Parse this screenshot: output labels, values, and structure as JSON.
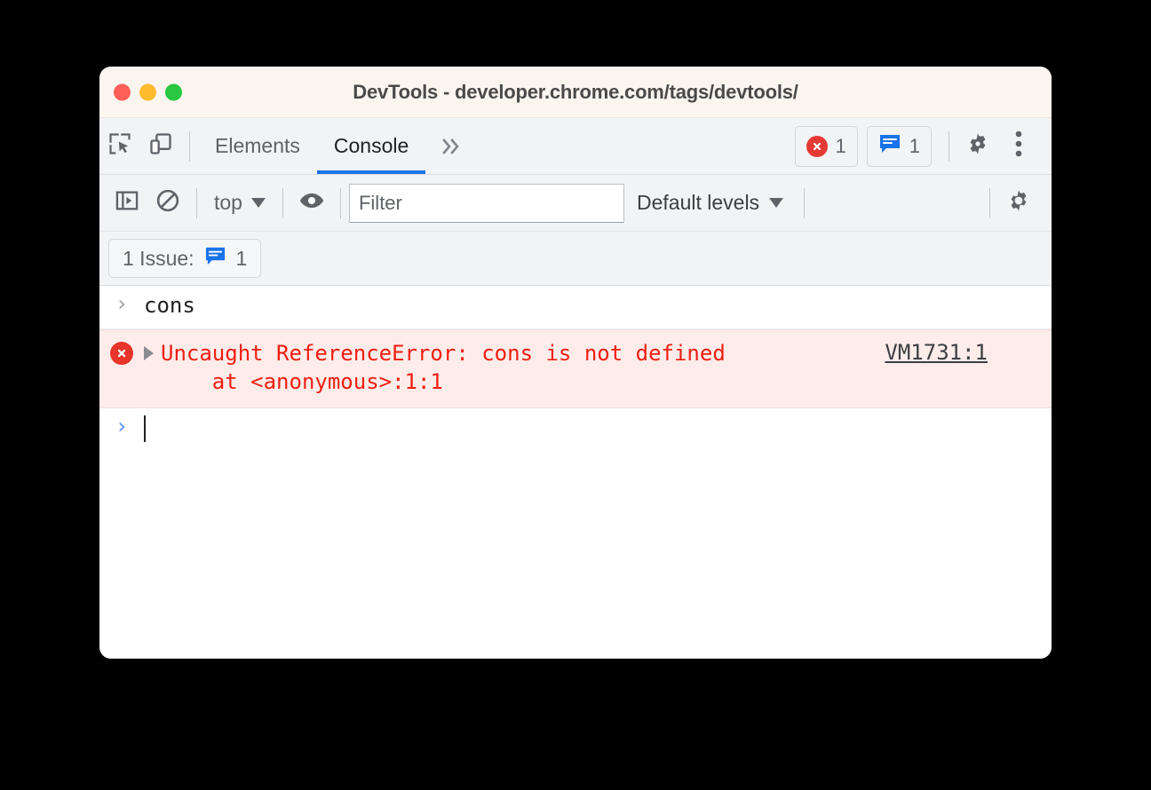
{
  "window": {
    "title": "DevTools - developer.chrome.com/tags/devtools/",
    "traffic_lights": [
      {
        "name": "close",
        "color": "#ff5f57"
      },
      {
        "name": "minimize",
        "color": "#febc2e"
      },
      {
        "name": "maximize",
        "color": "#28c840"
      }
    ]
  },
  "toolbar": {
    "inspect_icon": "inspect-element-icon",
    "device_icon": "device-toolbar-icon",
    "tabs": [
      {
        "label": "Elements",
        "active": false
      },
      {
        "label": "Console",
        "active": true
      }
    ],
    "more_tabs_label": "»",
    "error_count": "1",
    "issue_count": "1",
    "settings_icon": "gear-icon",
    "menu_icon": "kebab-menu-icon"
  },
  "console_toolbar": {
    "sidebar_icon": "console-sidebar-icon",
    "clear_icon": "clear-console-icon",
    "context": "top",
    "eye_icon": "live-expression-eye-icon",
    "filter_placeholder": "Filter",
    "filter_value": "",
    "levels_label": "Default levels",
    "settings_icon": "console-settings-gear-icon"
  },
  "issues_bar": {
    "label": "1 Issue:",
    "count": "1",
    "icon": "issue-speech-bubble-icon"
  },
  "console": {
    "input_echo": {
      "prompt": "›",
      "text": "cons"
    },
    "error": {
      "icon": "error-circle-icon",
      "expand_icon": "expand-triangle-icon",
      "line1": "Uncaught ReferenceError: cons is not defined",
      "line2": "    at <anonymous>:1:1",
      "source_link": "VM1731:1"
    },
    "prompt": {
      "prompt": "›",
      "value": ""
    }
  },
  "colors": {
    "accent": "#1a73e8",
    "error_red": "#f01e12",
    "error_bg": "#fdecea",
    "titlebar": "#faf5ef",
    "toolbar": "#f1f3f4"
  }
}
